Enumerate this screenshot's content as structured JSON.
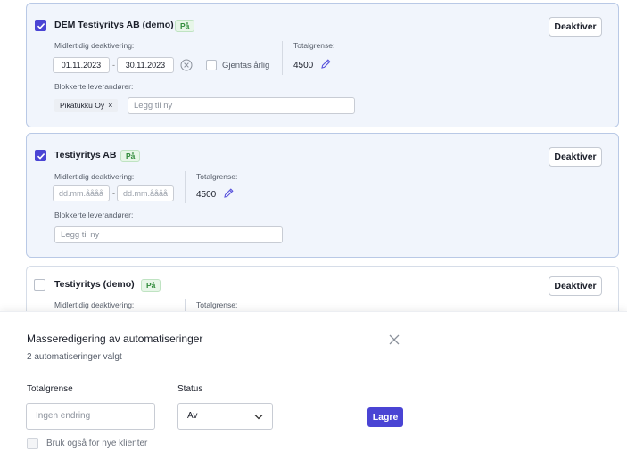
{
  "colors": {
    "accent": "#4a44d4",
    "badge_green": "#2f8a3a",
    "card_bg": "#f1f5fc",
    "card_border": "#b9c9e6"
  },
  "cards": [
    {
      "checked": true,
      "title": "DEM Testiyritys AB (demo)",
      "badge": "På",
      "deactivate_label": "Deaktiver",
      "temp_label": "Midlertidig deaktivering:",
      "date_from": "01.11.2023",
      "date_to": "30.11.2023",
      "dash": "-",
      "repeat_label": "Gjentas årlig",
      "limit_label": "Totalgrense:",
      "limit_value": "4500",
      "blocked_label": "Blokkerte leverandører:",
      "chip": "Pikatukku Oy",
      "chip_remove": "×",
      "add_placeholder": "Legg til ny"
    },
    {
      "checked": true,
      "title": "Testiyritys AB",
      "badge": "På",
      "deactivate_label": "Deaktiver",
      "temp_label": "Midlertidig deaktivering:",
      "date_from_placeholder": "dd.mm.åååå",
      "date_to_placeholder": "dd.mm.åååå",
      "dash": "-",
      "limit_label": "Totalgrense:",
      "limit_value": "4500",
      "blocked_label": "Blokkerte leverandører:",
      "add_placeholder": "Legg til ny"
    },
    {
      "checked": false,
      "title": "Testiyritys (demo)",
      "badge": "På",
      "deactivate_label": "Deaktiver",
      "temp_label": "Midlertidig deaktivering:",
      "limit_label": "Totalgrense:"
    }
  ],
  "panel": {
    "title": "Masseredigering av automatiseringer",
    "subtitle": "2 automatiseringer valgt",
    "limit_label": "Totalgrense",
    "limit_placeholder": "Ingen endring",
    "status_label": "Status",
    "status_value": "Av",
    "save_label": "Lagre",
    "new_clients_label": "Bruk også for nye klienter"
  }
}
